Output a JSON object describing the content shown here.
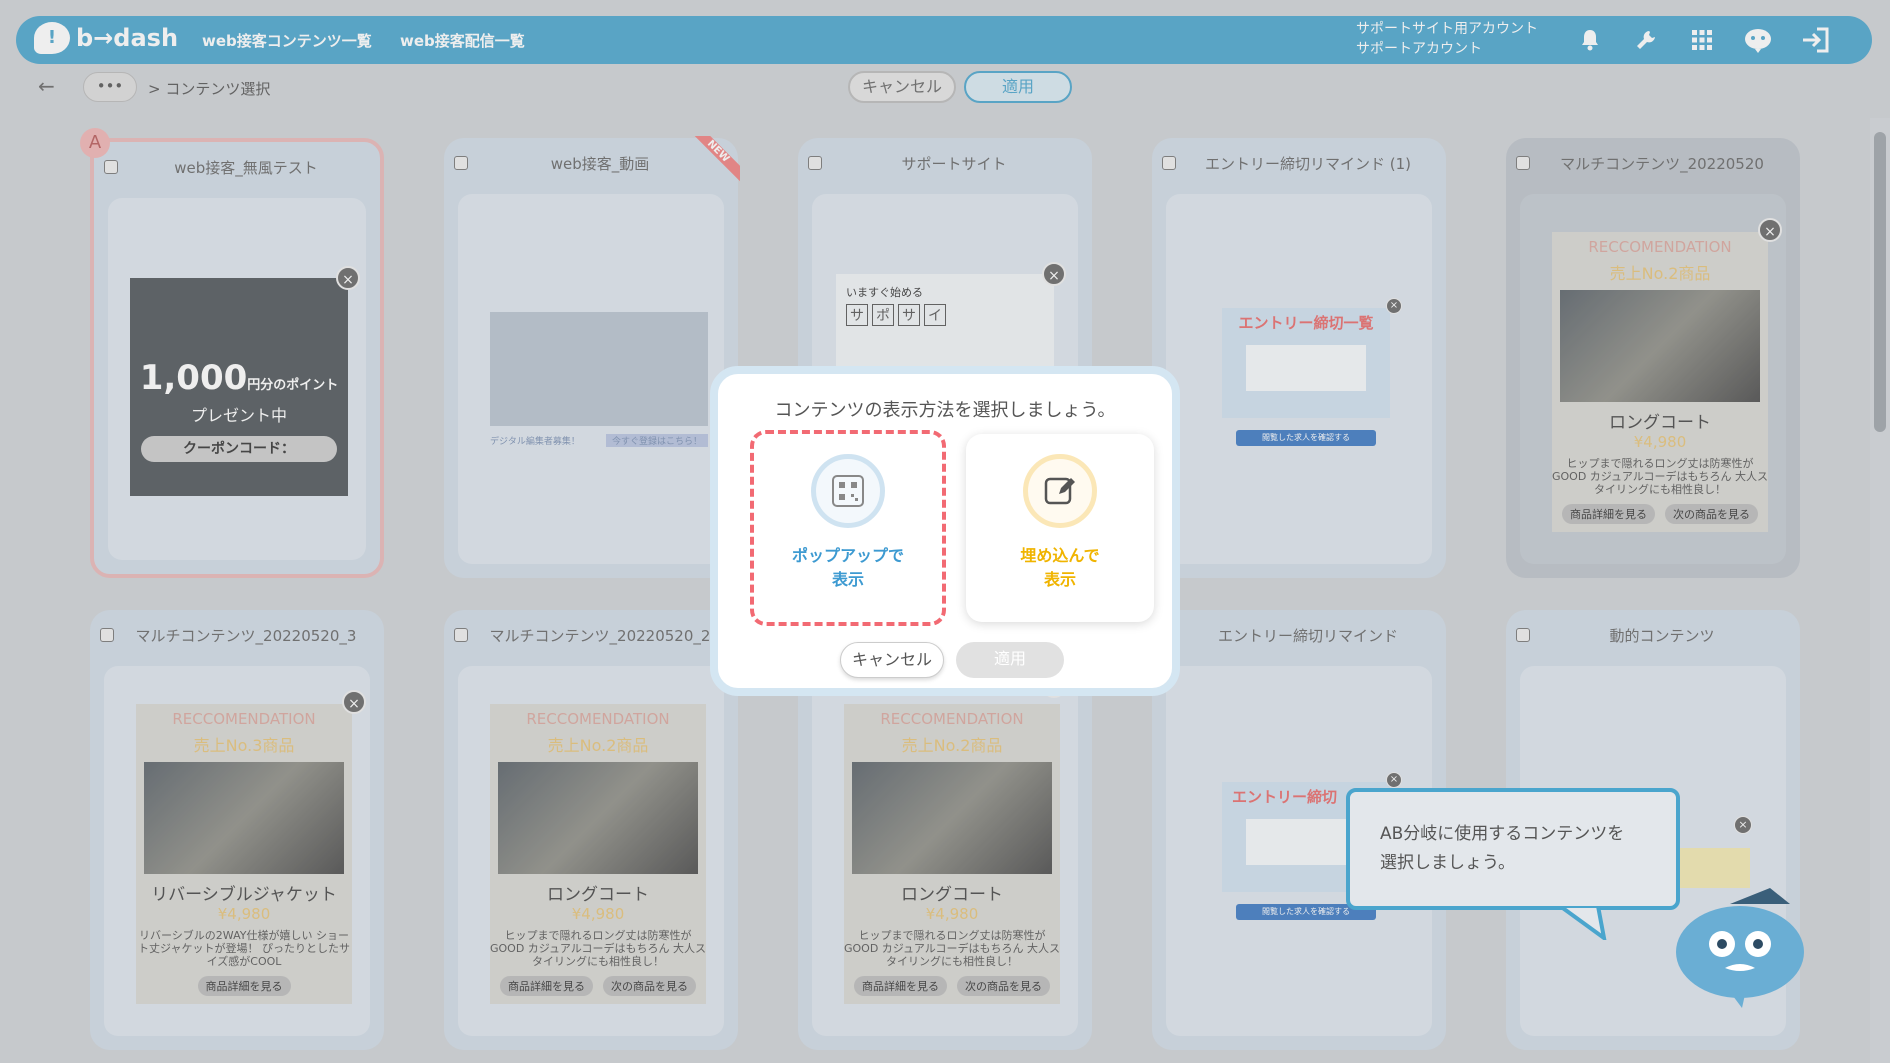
{
  "header": {
    "logo": "b→dash",
    "nav": [
      "web接客コンテンツ一覧",
      "web接客配信一覧"
    ],
    "account_line1": "サポートサイト用アカウント",
    "account_line2": "サポートアカウント",
    "icons": [
      "bell-icon",
      "wrench-icon",
      "apps-grid-icon",
      "support-cloud-icon",
      "logout-icon"
    ]
  },
  "subbar": {
    "back": "←",
    "more": "•••",
    "breadcrumb": "> コンテンツ選択",
    "cancel": "キャンセル",
    "apply": "適用"
  },
  "cards": [
    {
      "title": "web接客_無風テスト",
      "badge": "A"
    },
    {
      "title": "web接客_動画",
      "ribbon": "NEW"
    },
    {
      "title": "サポートサイト"
    },
    {
      "title": "エントリー締切リマインド (1)"
    },
    {
      "title": "マルチコンテンツ_20220520"
    },
    {
      "title": "マルチコンテンツ_20220520_3"
    },
    {
      "title": "マルチコンテンツ_20220520_2"
    },
    {
      "title": ""
    },
    {
      "title": "エントリー締切リマインド"
    },
    {
      "title": "動的コンテンツ"
    }
  ],
  "previews": {
    "coupon_amount": "1,000",
    "coupon_unit": "円分のポイント",
    "coupon_present": "プレゼント中",
    "coupon_code": "クーポンコード：",
    "video_caption_left": "デジタル編集者募集！",
    "video_caption_right": "今すぐ登録はこちら！",
    "support_lead": "いますぐ始める",
    "support_chars": [
      "サ",
      "ポ",
      "サ",
      "イ"
    ],
    "entry_title": "エントリー締切一覧",
    "entry_title_cut": "エントリー締切",
    "entry_button": "閲覧した求人を確認する",
    "recs": [
      {
        "head": "RECCOMENDATION",
        "rank": "売上No.2商品",
        "name": "ロングコート",
        "price": "¥4,980",
        "desc": "ヒップまで隠れるロング丈は防寒性がGOOD カジュアルコーデはもちろん 大人スタイリングにも相性良し！",
        "btn1": "商品詳細を見る",
        "btn2": "次の商品を見る"
      },
      {
        "head": "RECCOMENDATION",
        "rank": "売上No.3商品",
        "name": "リバーシブルジャケット",
        "price": "¥4,980",
        "desc": "リバーシブルの2WAY仕様が嬉しい ショート丈ジャケットが登場！ ぴったりとしたサイズ感がCOOL",
        "btn1": "商品詳細を見る",
        "btn2": ""
      },
      {
        "head": "RECCOMENDATION",
        "rank": "売上No.2商品",
        "name": "ロングコート",
        "price": "¥4,980",
        "desc": "ヒップまで隠れるロング丈は防寒性がGOOD カジュアルコーデはもちろん 大人スタイリングにも相性良し！",
        "btn1": "商品詳細を見る",
        "btn2": "次の商品を見る"
      },
      {
        "head": "RECCOMENDATION",
        "rank": "売上No.2商品",
        "name": "ロングコート",
        "price": "¥4,980",
        "desc": "ヒップまで隠れるロング丈は防寒性がGOOD カジュアルコーデはもちろん 大人スタイリングにも相性良し！",
        "btn1": "商品詳細を見る",
        "btn2": "次の商品を見る"
      }
    ]
  },
  "modal": {
    "title": "コンテンツの表示方法を選択しましょう。",
    "option_popup": "ポップアップで\n表示",
    "option_popup_l1": "ポップアップで",
    "option_popup_l2": "表示",
    "option_embed_l1": "埋め込んで",
    "option_embed_l2": "表示",
    "cancel": "キャンセル",
    "apply": "適用"
  },
  "tooltip": {
    "line1": "AB分岐に使用するコンテンツを",
    "line2": "選択しましょう。"
  },
  "colors": {
    "accent": "#4aa5cd",
    "highlight": "#f26a73",
    "embed": "#f0b400"
  }
}
